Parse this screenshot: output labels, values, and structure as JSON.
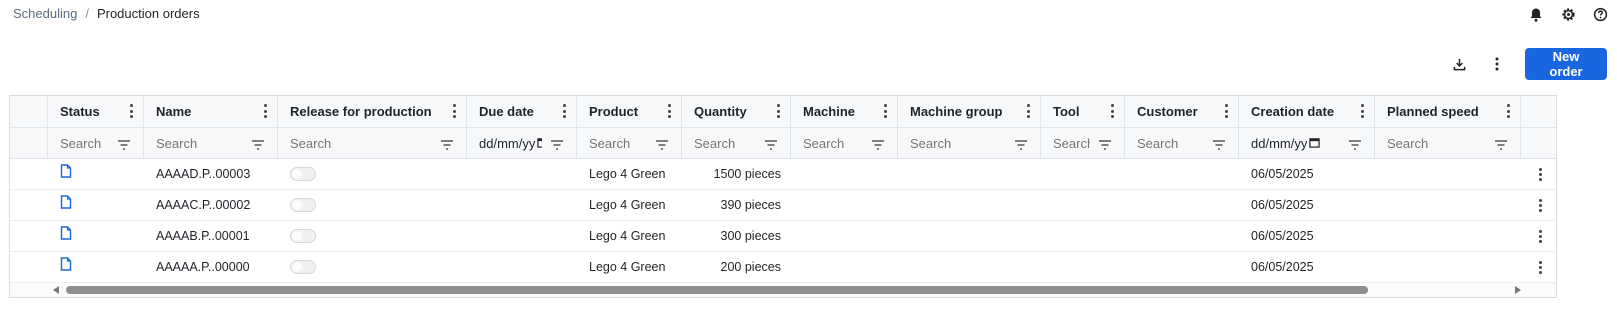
{
  "breadcrumb": {
    "parent": "Scheduling",
    "separator": "/",
    "current": "Production orders"
  },
  "top_icons": [
    "bell-icon",
    "gear-icon",
    "help-icon"
  ],
  "toolbar": {
    "new_order_label": "New order",
    "accent": "#1a66e0"
  },
  "columns": [
    {
      "label": "Status",
      "filter": "Search"
    },
    {
      "label": "Name",
      "filter": "Search"
    },
    {
      "label": "Release for production",
      "filter": "Search"
    },
    {
      "label": "Due date",
      "filter": "dd/mm/yy"
    },
    {
      "label": "Product",
      "filter": "Search"
    },
    {
      "label": "Quantity",
      "filter": "Search"
    },
    {
      "label": "Machine",
      "filter": "Search"
    },
    {
      "label": "Machine group",
      "filter": "Search"
    },
    {
      "label": "Tool",
      "filter": "Search"
    },
    {
      "label": "Customer",
      "filter": "Search"
    },
    {
      "label": "Creation date",
      "filter": "dd/mm/yy"
    },
    {
      "label": "Planned speed",
      "filter": "Search"
    }
  ],
  "rows": [
    {
      "status_icon": "document-icon",
      "name": "AAAAD.P..00003",
      "release": false,
      "due_date": "",
      "product": "Lego 4 Green",
      "quantity": "1500 pieces",
      "machine": "",
      "machine_group": "",
      "tool": "",
      "customer": "",
      "creation_date": "06/05/2025",
      "planned_speed": ""
    },
    {
      "status_icon": "document-icon",
      "name": "AAAAC.P..00002",
      "release": false,
      "due_date": "",
      "product": "Lego 4 Green",
      "quantity": "390 pieces",
      "machine": "",
      "machine_group": "",
      "tool": "",
      "customer": "",
      "creation_date": "06/05/2025",
      "planned_speed": ""
    },
    {
      "status_icon": "document-icon",
      "name": "AAAAB.P..00001",
      "release": false,
      "due_date": "",
      "product": "Lego 4 Green",
      "quantity": "300 pieces",
      "machine": "",
      "machine_group": "",
      "tool": "",
      "customer": "",
      "creation_date": "06/05/2025",
      "planned_speed": ""
    },
    {
      "status_icon": "document-icon",
      "name": "AAAAA.P..00000",
      "release": false,
      "due_date": "",
      "product": "Lego 4 Green",
      "quantity": "200 pieces",
      "machine": "",
      "machine_group": "",
      "tool": "",
      "customer": "",
      "creation_date": "06/05/2025",
      "planned_speed": ""
    }
  ]
}
